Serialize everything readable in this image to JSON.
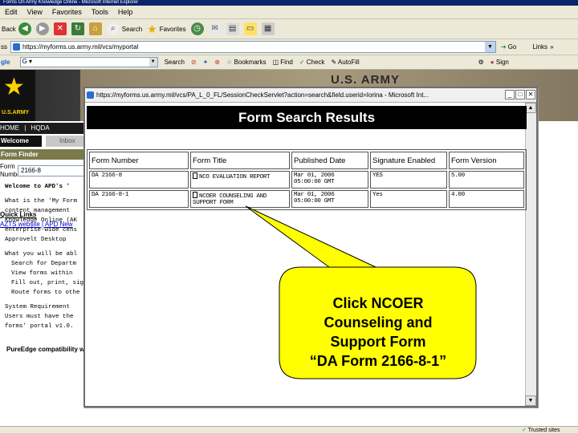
{
  "browser": {
    "title": "Forms On Army Knowledge Online - Microsoft Internet Explorer",
    "menu": [
      "Edit",
      "View",
      "Favorites",
      "Tools",
      "Help"
    ],
    "toolbar": {
      "back": "Back",
      "search": "Search",
      "favorites": "Favorites"
    },
    "address_label": "ss",
    "address": "https://myforms.us.army.mil/vcs/myportal",
    "go": "Go",
    "links": "Links",
    "google": {
      "logo": "gle",
      "search_btn": "Search",
      "bookmarks": "Bookmarks",
      "find": "Find",
      "check": "Check",
      "autofill": "AutoFill",
      "signin": "Sign"
    },
    "status": "Trusted sites"
  },
  "portal": {
    "banner_title": "U.S. ARMY",
    "logo_text": "U.S.ARMY",
    "nav": {
      "home": "HOME",
      "hqda": "HQDA",
      "welcome": "Welcome",
      "inbox": "Inbox"
    },
    "form_finder": {
      "title": "Form Finder",
      "label1": "Form",
      "label2": "Number:",
      "value": "2166-8"
    },
    "quick_links": {
      "title": "Quick Links",
      "link1": "AZTS website",
      "link2": "APD New"
    },
    "welcome_heading": "Welcome to APD's '",
    "body_lines": [
      "What is the 'My Form",
      "content management",
      "Knowledge Online (AK",
      "enterprise-wide cens",
      "Approvelt Desktop",
      "",
      "What you will be abl",
      "  Search for Departm",
      "  View forms within",
      "  Fill out, print, sign,",
      "  Route forms to othe",
      "",
      "System Requirement",
      "Users must have the",
      "forms' portal v1.0."
    ],
    "pureedge": "PureEdge compatibility with Vista operating system:"
  },
  "popup": {
    "title": "https://myforms.us.army.mil/vcs/PA_L_0_FL/SessionCheckServlet?action=search&field.userid=Iorina - Microsoft Int...",
    "header": "Form Search Results",
    "columns": [
      "Form Number",
      "Form Title",
      "Published Date",
      "Signature Enabled",
      "Form Version"
    ],
    "rows": [
      {
        "number": "DA 2166-8",
        "title": "NCO EVALUATION REPORT",
        "date1": "Mar 01, 2006",
        "date2": "05:00:00 GMT",
        "sig": "YES",
        "version": "5.00"
      },
      {
        "number": "DA 2166-8-1",
        "title1": "NCOER COUNSELING AND",
        "title2": "SUPPORT FORM",
        "date1": "Mar 01, 2006",
        "date2": "05:00:00 GMT",
        "sig": "Yes",
        "version": "4.00"
      }
    ]
  },
  "callout": {
    "lines": [
      "Click NCOER",
      "Counseling and",
      "Support Form",
      "“DA Form 2166-8-1”"
    ],
    "fill": "#ffff00"
  }
}
